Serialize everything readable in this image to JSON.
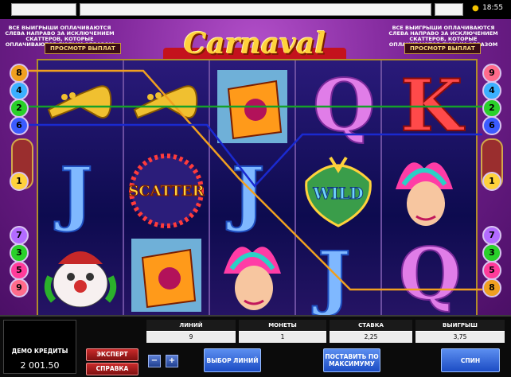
{
  "status": {
    "time": "18:55"
  },
  "info": {
    "left_text": "ВСЕ ВЫИГРЫШИ ОПЛАЧИВАЮТСЯ СЛЕВА НАПРАВО ЗА ИСКЛЮЧЕНИЕМ СКАТТЕРОВ, КОТОРЫЕ ОПЛАЧИВАЮТСЯ ЛЮБЫМ ОБРАЗОМ",
    "right_text": "ВСЕ ВЫИГРЫШИ ОПЛАЧИВАЮТСЯ СЛЕВА НАПРАВО ЗА ИСКЛЮЧЕНИЕМ СКАТТЕРОВ, КОТОРЫЕ ОПЛАЧИВАЮТСЯ ЛЮБЫМ ОБРАЗОМ",
    "paytable_label": "ПРОСМОТР ВЫПЛАТ"
  },
  "logo": {
    "text": "Carnaval"
  },
  "reels": {
    "wild_label": "WILD",
    "scatter_label": "SCATTER",
    "j": "J",
    "q": "Q",
    "k": "K"
  },
  "paylines": {
    "left": [
      "8",
      "4",
      "2",
      "6",
      "1",
      "7",
      "3",
      "5",
      "9"
    ],
    "right": [
      "9",
      "4",
      "2",
      "6",
      "1",
      "7",
      "3",
      "5",
      "8"
    ],
    "colors": {
      "orange": "#f0a020",
      "green": "#15a02a",
      "blue": "#1a2ad0"
    }
  },
  "controls": {
    "credits_label": "ДЕМО КРЕДИТЫ",
    "credits_value": "2 001.50",
    "expert": "ЭКСПЕРТ",
    "help": "СПРАВКА",
    "minus": "−",
    "plus": "+",
    "select_lines": "ВЫБОР ЛИНИЙ",
    "bet_max": "ПОСТАВИТЬ ПО МАКСИМУМУ",
    "spin": "СПИН",
    "stats": [
      {
        "label": "ЛИНИЙ",
        "value": "9"
      },
      {
        "label": "МОНЕТЫ",
        "value": "1"
      },
      {
        "label": "СТАВКА",
        "value": "2,25"
      },
      {
        "label": "ВЫИГРЫШ",
        "value": "3,75"
      }
    ]
  }
}
